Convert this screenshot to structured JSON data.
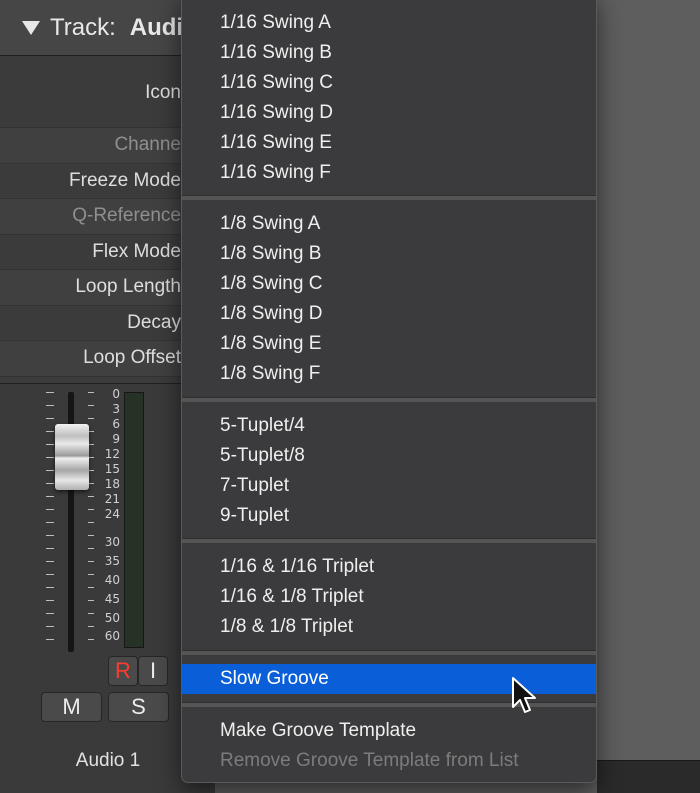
{
  "inspector": {
    "track_label": "Track:",
    "track_name": "Audi",
    "params": [
      {
        "label": "Icon",
        "dim": false
      },
      {
        "label": "Channe",
        "dim": true
      },
      {
        "label": "Freeze Mode",
        "dim": false
      },
      {
        "label": "Q-Reference",
        "dim": true
      },
      {
        "label": "Flex Mode",
        "dim": false
      },
      {
        "label": "Loop Length",
        "dim": false
      },
      {
        "label": "Decay",
        "dim": false
      },
      {
        "label": "Loop Offset",
        "dim": false
      }
    ]
  },
  "channel_strip": {
    "meter_scale": [
      "0",
      "3",
      "6",
      "9",
      "12",
      "15",
      "18",
      "21",
      "24",
      "30",
      "35",
      "40",
      "45",
      "50",
      "60"
    ],
    "record_label": "R",
    "input_label": "I",
    "mute_label": "M",
    "solo_label": "S",
    "channel_name": "Audio 1"
  },
  "menu": {
    "groups": [
      [
        "1/16 Swing A",
        "1/16 Swing B",
        "1/16 Swing C",
        "1/16 Swing D",
        "1/16 Swing E",
        "1/16 Swing F"
      ],
      [
        "1/8 Swing A",
        "1/8 Swing B",
        "1/8 Swing C",
        "1/8 Swing D",
        "1/8 Swing E",
        "1/8 Swing F"
      ],
      [
        "5-Tuplet/4",
        "5-Tuplet/8",
        "7-Tuplet",
        "9-Tuplet"
      ],
      [
        "1/16 & 1/16 Triplet",
        "1/16 & 1/8 Triplet",
        "1/8 & 1/8 Triplet"
      ],
      [
        "Slow Groove"
      ],
      [
        "Make Groove Template",
        "Remove Groove Template from List"
      ]
    ],
    "selected": "Slow Groove",
    "disabled": [
      "Remove Groove Template from List"
    ],
    "highlight_color": "#0a5fd9"
  },
  "colors": {
    "record": "#ff3b30"
  },
  "icons": {
    "disclosure": "disclosure-triangle-icon",
    "cursor": "arrow-cursor-icon"
  }
}
